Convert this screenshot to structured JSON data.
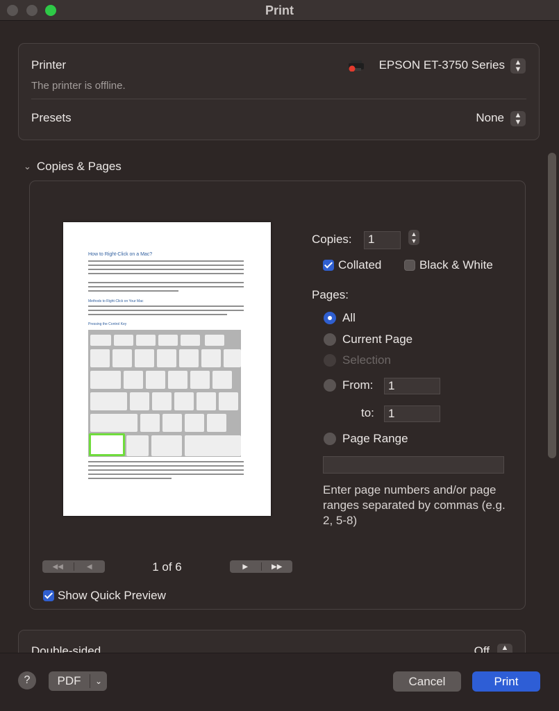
{
  "window": {
    "title": "Print"
  },
  "printer_section": {
    "printer_label": "Printer",
    "printer_value": "EPSON ET-3750 Series",
    "printer_status": "The printer is offline.",
    "presets_label": "Presets",
    "presets_value": "None"
  },
  "copies_pages": {
    "section_title": "Copies & Pages",
    "preview": {
      "doc_title": "How to Right-Click on a Mac?",
      "heading_methods": "Methods to Right-Click on Your Mac",
      "heading_control": "Pressing the Control Key",
      "page_counter": "1 of 6",
      "nav_first": "◀◀",
      "nav_prev": "◀",
      "nav_next": "▶",
      "nav_last": "▶▶"
    },
    "show_quick_preview": {
      "label": "Show Quick Preview",
      "checked": true
    },
    "copies": {
      "label": "Copies:",
      "value": "1"
    },
    "collated": {
      "label": "Collated",
      "checked": true
    },
    "black_white": {
      "label": "Black & White",
      "checked": false
    },
    "pages": {
      "label": "Pages:",
      "all": "All",
      "current_page": "Current Page",
      "selection": "Selection",
      "from_label": "From:",
      "from_value": "1",
      "to_label": "to:",
      "to_value": "1",
      "page_range": "Page Range",
      "page_range_value": "",
      "selected": "All"
    },
    "help_text": "Enter page numbers and/or page ranges separated by commas (e.g. 2, 5-8)"
  },
  "double_sided": {
    "label": "Double-sided",
    "value": "Off"
  },
  "footer": {
    "help": "?",
    "pdf": "PDF",
    "cancel": "Cancel",
    "print": "Print"
  },
  "colors": {
    "accent": "#2e5ed6",
    "printer_offline_dot": "#e23b2e",
    "maximize_button": "#2ec947"
  },
  "icons": [
    "printer-icon",
    "chevron-updown-icon",
    "chevron-down-icon",
    "checkmark-icon",
    "help-icon"
  ]
}
